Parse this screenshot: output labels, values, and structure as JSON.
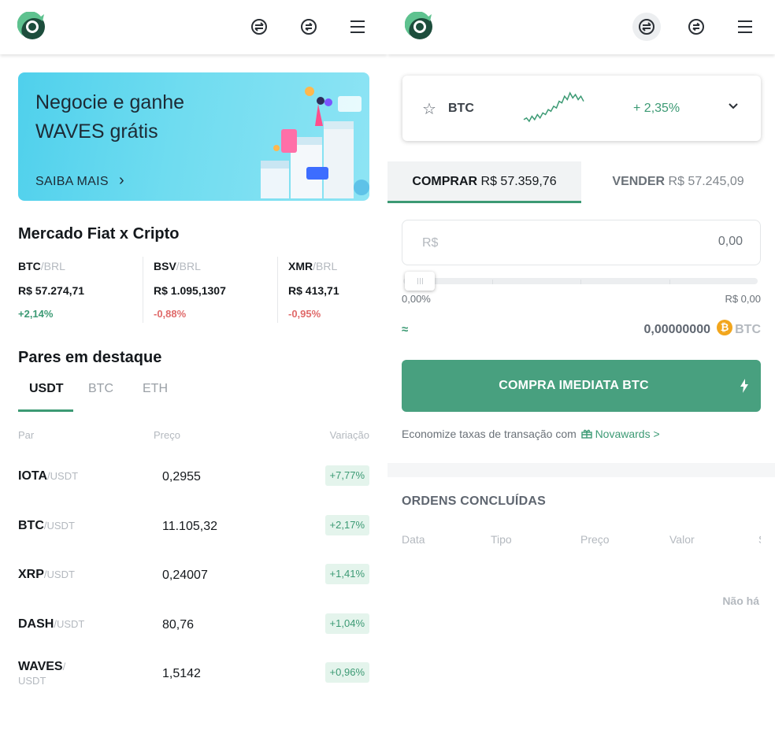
{
  "colors": {
    "accent": "#3c9a74",
    "negative": "#e06a6a",
    "button": "#48a07f",
    "bitcoin": "#f2a61d"
  },
  "left": {
    "banner": {
      "title": "Negocie e ganhe WAVES grátis",
      "cta": "SAIBA MAIS",
      "cta_arrow": "›"
    },
    "market": {
      "title": "Mercado Fiat x Cripto",
      "items": [
        {
          "base": "BTC",
          "quote": "/BRL",
          "price": "R$ 57.274,71",
          "change": "+2,14%"
        },
        {
          "base": "BSV",
          "quote": "/BRL",
          "price": "R$ 1.095,1307",
          "change": "-0,88%"
        },
        {
          "base": "XMR",
          "quote": "/BRL",
          "price": "R$ 413,71",
          "change": "-0,95%"
        }
      ]
    },
    "featured": {
      "title": "Pares em destaque",
      "tabs": [
        "USDT",
        "BTC",
        "ETH"
      ],
      "active_tab": "USDT",
      "headers": {
        "pair": "Par",
        "price": "Preço",
        "change": "Variação"
      },
      "rows": [
        {
          "base": "IOTA",
          "quote": "/USDT",
          "price": "0,2955",
          "change": "+7,77%"
        },
        {
          "base": "BTC",
          "quote": "/USDT",
          "price": "11.105,32",
          "change": "+2,17%"
        },
        {
          "base": "XRP",
          "quote": "/USDT",
          "price": "0,24007",
          "change": "+1,41%"
        },
        {
          "base": "DASH",
          "quote": "/USDT",
          "price": "80,76",
          "change": "+1,04%"
        },
        {
          "base": "WAVES",
          "quote": "/",
          "quote2": "USDT",
          "price": "1,5142",
          "change": "+0,96%"
        }
      ]
    }
  },
  "right": {
    "ticker": {
      "symbol": "BTC",
      "change": "+ 2,35%",
      "star": "☆",
      "sparkline": [
        6,
        7,
        5,
        8,
        6,
        9,
        7,
        10,
        9,
        12,
        11,
        14,
        13,
        17,
        16,
        20,
        18,
        22,
        19,
        21,
        18,
        20,
        17
      ]
    },
    "tabs": {
      "buy_label": "COMPRAR",
      "buy_price": "R$ 57.359,76",
      "sell_label": "VENDER",
      "sell_price": "R$ 57.245,09"
    },
    "amount": {
      "currency": "R$",
      "value": "0,00"
    },
    "slider": {
      "level": 0,
      "min_label": "0,00%",
      "max_label": "R$ 0,00"
    },
    "estimate": {
      "approx": "≈",
      "value": "0,00000000",
      "coin_glyph": "₿",
      "symbol": "BTC"
    },
    "buy_button": "COMPRA IMEDIATA BTC",
    "promo": {
      "text": "Economize taxas de transação com",
      "link": "Novawards >"
    },
    "orders": {
      "title": "ORDENS CONCLUÍDAS",
      "headers": [
        "Data",
        "Tipo",
        "Preço",
        "Valor",
        "S"
      ],
      "empty": "Não há"
    }
  },
  "icons": {
    "logo": "novadax-logo",
    "swap": "swap-icon",
    "convert": "convert-icon",
    "menu": "menu-icon"
  }
}
